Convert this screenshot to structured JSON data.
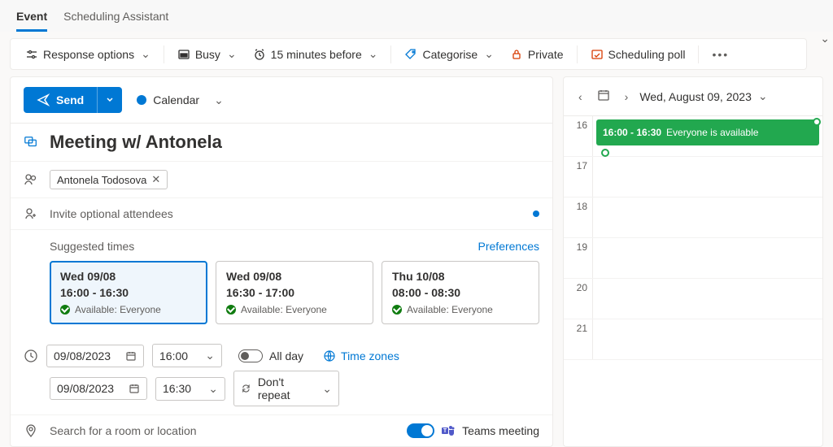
{
  "tabs": {
    "event": "Event",
    "scheduling": "Scheduling Assistant"
  },
  "toolbar": {
    "response": "Response options",
    "busy": "Busy",
    "reminder": "15 minutes before",
    "categorise": "Categorise",
    "private": "Private",
    "poll": "Scheduling poll"
  },
  "send": {
    "label": "Send",
    "calendar": "Calendar"
  },
  "form": {
    "title": "Meeting w/ Antonela",
    "attendee": "Antonela Todosova",
    "optional_placeholder": "Invite optional attendees",
    "suggested_label": "Suggested times",
    "preferences": "Preferences",
    "cards": [
      {
        "day": "Wed 09/08",
        "time": "16:00 - 16:30",
        "avail": "Available: Everyone"
      },
      {
        "day": "Wed 09/08",
        "time": "16:30 - 17:00",
        "avail": "Available: Everyone"
      },
      {
        "day": "Thu 10/08",
        "time": "08:00 - 08:30",
        "avail": "Available: Everyone"
      }
    ],
    "start_date": "09/08/2023",
    "start_time": "16:00",
    "end_date": "09/08/2023",
    "end_time": "16:30",
    "allday": "All day",
    "timezones": "Time zones",
    "repeat": "Don't repeat",
    "location_placeholder": "Search for a room or location",
    "teams": "Teams meeting"
  },
  "right": {
    "date_label": "Wed, August 09, 2023",
    "hours": [
      "16",
      "17",
      "18",
      "19",
      "20",
      "21"
    ],
    "event_time": "16:00 - 16:30",
    "event_text": "Everyone is available"
  }
}
